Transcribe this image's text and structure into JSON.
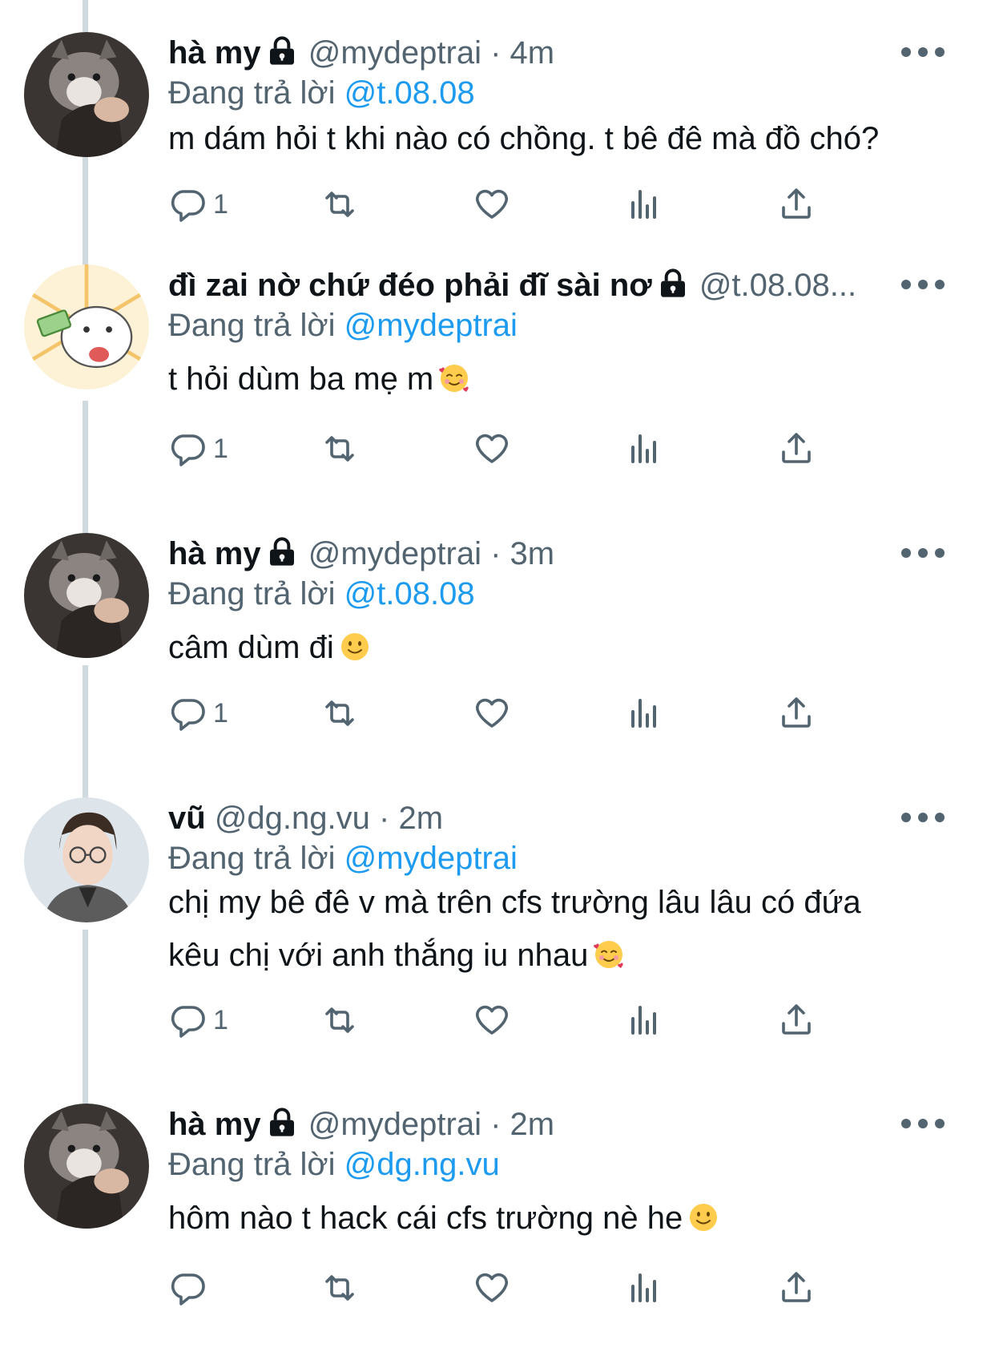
{
  "reply_prefix": "Đang trả lời",
  "tweets": [
    {
      "name": "hà my",
      "locked": true,
      "handle": "@mydeptrai",
      "time": "4m",
      "reply_to": "@t.08.08",
      "text": "m dám hỏi t khi nào có chồng. t bê đê mà đồ chó?",
      "reply_count": "1",
      "avatar": "cat-hand"
    },
    {
      "name": "đì zai nờ chứ đéo phải đĩ sài nơ",
      "locked": true,
      "handle": "@t.08.08...",
      "time": "",
      "reply_to": "@mydeptrai",
      "text": "t hỏi dùm ba mẹ m",
      "emoji": "smiling-face-with-hearts",
      "reply_count": "1",
      "avatar": "cartoon-cat-money"
    },
    {
      "name": "hà my",
      "locked": true,
      "handle": "@mydeptrai",
      "time": "3m",
      "reply_to": "@t.08.08",
      "text": "câm dùm đi",
      "emoji": "slightly-smiling-face",
      "reply_count": "1",
      "avatar": "cat-hand"
    },
    {
      "name": "vũ",
      "locked": false,
      "handle": "@dg.ng.vu",
      "time": "2m",
      "reply_to": "@mydeptrai",
      "text_lines": [
        "chị my bê đê v mà trên cfs trường lâu lâu có đứa",
        "kêu chị với anh thắng iu nhau"
      ],
      "emoji": "smiling-face-with-hearts",
      "reply_count": "1",
      "avatar": "person-glasses"
    },
    {
      "name": "hà my",
      "locked": true,
      "handle": "@mydeptrai",
      "time": "2m",
      "reply_to": "@dg.ng.vu",
      "text": "hôm nào t hack cái cfs trường nè he",
      "emoji": "slightly-smiling-face",
      "reply_count": "",
      "avatar": "cat-hand"
    }
  ],
  "colors": {
    "text": "#0f1419",
    "secondary": "#536471",
    "link": "#1d9bf0",
    "thread_line": "#cfd9de"
  }
}
